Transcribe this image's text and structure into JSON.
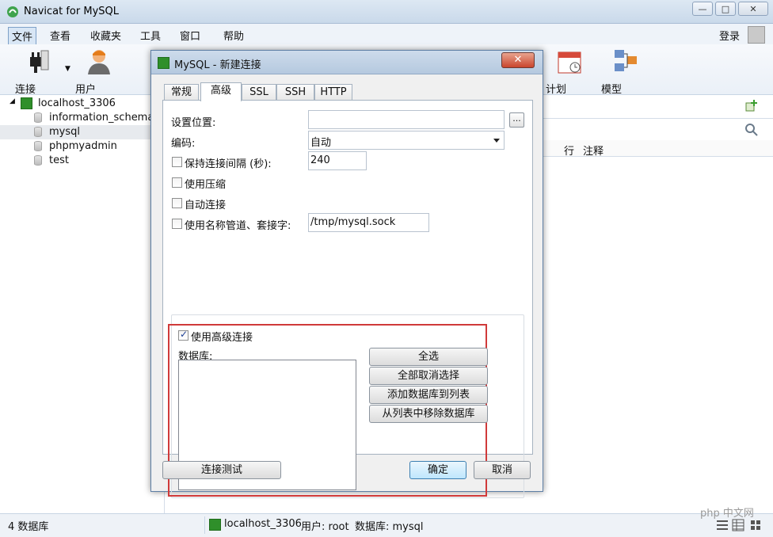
{
  "window": {
    "title": "Navicat for MySQL",
    "controls": {
      "minimize": "—",
      "maximize": "□",
      "close": "✕"
    }
  },
  "menu": {
    "items": [
      "文件",
      "查看",
      "收藏夹",
      "工具",
      "窗口",
      "帮助"
    ],
    "login": "登录"
  },
  "toolbar": {
    "connect": "连接",
    "user": "用户",
    "schedule": "计划",
    "model": "模型"
  },
  "tree": {
    "connection": "localhost_3306",
    "databases": [
      "information_schema",
      "mysql",
      "phpmyadmin",
      "test"
    ],
    "selected": "mysql"
  },
  "content": {
    "columns": [
      "行",
      "注释"
    ]
  },
  "statusbar": {
    "db_count": "4 数据库",
    "connection": "localhost_3306",
    "user": "用户: root",
    "database": "数据库: mysql"
  },
  "dialog": {
    "title": "MySQL - 新建连接",
    "close": "✕",
    "tabs": [
      "常规",
      "高级",
      "SSL",
      "SSH",
      "HTTP"
    ],
    "active_tab": "高级",
    "settings_location_label": "设置位置:",
    "settings_location_value": "",
    "browse": "...",
    "encoding_label": "编码:",
    "encoding_value": "自动",
    "keepalive_label": "保持连接间隔 (秒):",
    "keepalive_checked": false,
    "keepalive_value": "240",
    "compression_label": "使用压缩",
    "compression_checked": false,
    "autoconnect_label": "自动连接",
    "autoconnect_checked": false,
    "named_pipe_label": "使用名称管道、套接字:",
    "named_pipe_checked": false,
    "named_pipe_value": "/tmp/mysql.sock",
    "advanced_conn_label": "使用高级连接",
    "advanced_conn_checked": true,
    "databases_label": "数据库:",
    "select_all": "全选",
    "deselect_all": "全部取消选择",
    "add_db": "添加数据库到列表",
    "remove_db": "从列表中移除数据库",
    "test_connection": "连接测试",
    "ok": "确定",
    "cancel": "取消"
  },
  "watermark": "php 中文网"
}
